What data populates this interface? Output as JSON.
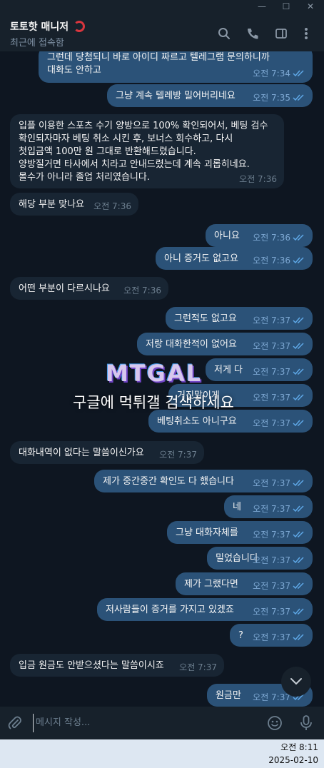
{
  "window": {
    "minimize": "—",
    "maximize": "☐",
    "close": "✕"
  },
  "header": {
    "title": "토토핫 매니저",
    "status": "최근에 접속함"
  },
  "messages": [
    {
      "dir": "out",
      "text": "그런데 당첨되니 바로 아이디 짜르고 텔레그램 문의하니까\n대화도 안하고",
      "time": "오전 7:34"
    },
    {
      "dir": "out",
      "text": "그냥 계속 텔레방 밀어버리네요",
      "time": "오전 7:35"
    },
    {
      "dir": "in",
      "text": "입플 이용한 스포츠 수기 양방으로 100% 확인되어서, 베팅 검수\n확인되자마자 베팅 취소 시킨 후, 보너스 회수하고, 다시\n첫입금액 100만 원 그대로 반환해드렸습니다.\n양방질거면 타사에서 치라고 안내드렸는데 계속 괴롭히네요.\n몰수가 아니라 졸업 처리였습니다.",
      "time": "오전 7:36"
    },
    {
      "dir": "in",
      "text": "해당 부분 맞나요",
      "time": "오전 7:36"
    },
    {
      "dir": "out",
      "text": "아니요",
      "time": "오전 7:36"
    },
    {
      "dir": "out",
      "text": "아니 증거도 없고요",
      "time": "오전 7:36"
    },
    {
      "dir": "in",
      "text": "어떤 부분이 다르시나요",
      "time": "오전 7:36"
    },
    {
      "dir": "out",
      "text": "그런적도 없고요",
      "time": "오전 7:37"
    },
    {
      "dir": "out",
      "text": "저랑 대화한적이 없어요",
      "time": "오전 7:37"
    },
    {
      "dir": "out",
      "text": "저게 다",
      "time": "오전 7:37"
    },
    {
      "dir": "out",
      "text": "거짓말이게",
      "time": "오전 7:37"
    },
    {
      "dir": "out",
      "text": "베팅취소도 아니구요",
      "time": "오전 7:37"
    },
    {
      "dir": "in",
      "text": "대화내역이 없다는 말씀이신가요",
      "time": "오전 7:37"
    },
    {
      "dir": "out",
      "text": "제가 중간중간 확인도 다 했습니다",
      "time": "오전 7:37"
    },
    {
      "dir": "out",
      "text": "네",
      "time": "오전 7:37"
    },
    {
      "dir": "out",
      "text": "그냥 대화자체를",
      "time": "오전 7:37"
    },
    {
      "dir": "out",
      "text": "밀었습니다",
      "time": "오전 7:37"
    },
    {
      "dir": "out",
      "text": "제가 그랬다면",
      "time": "오전 7:37"
    },
    {
      "dir": "out",
      "text": "저사람들이 증거를 가지고 있겠죠",
      "time": "오전 7:37"
    },
    {
      "dir": "out",
      "text": "?",
      "time": "오전 7:37"
    },
    {
      "dir": "in",
      "text": "입금 원금도 안받으셨다는 말씀이시죠",
      "time": "오전 7:37"
    },
    {
      "dir": "out",
      "text": "원금만",
      "time": "오전 7:37"
    }
  ],
  "watermark": {
    "logo": "MTGAL",
    "text": "구글에 먹튀갤 검색하세요"
  },
  "composer": {
    "placeholder": "메시지 작성..."
  },
  "taskbar": {
    "time": "오전 8:11",
    "date": "2025-02-10"
  },
  "colors": {
    "background": "#0e1621",
    "outgoing": "#2b5278",
    "incoming": "#182533",
    "header": "#17212b",
    "accent": "#5ea7e6"
  }
}
